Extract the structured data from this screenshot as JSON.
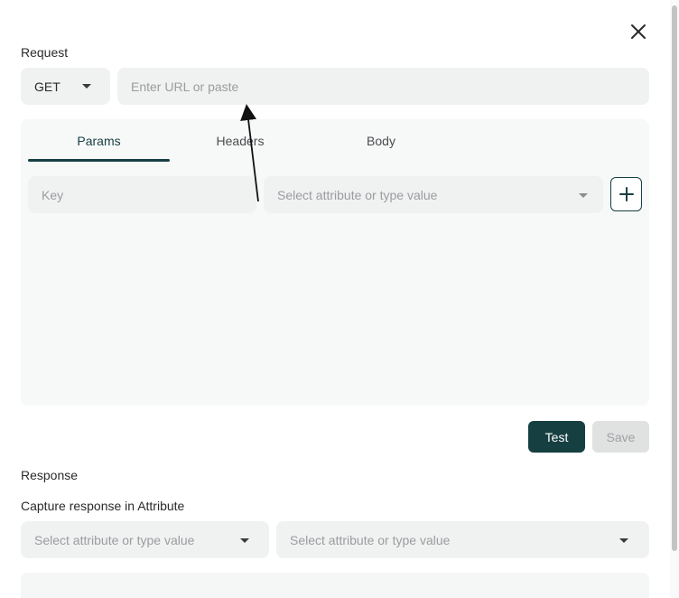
{
  "request": {
    "section_label": "Request",
    "method": {
      "value": "GET"
    },
    "url": {
      "placeholder": "Enter URL or paste"
    },
    "tabs": [
      {
        "label": "Params",
        "active": true
      },
      {
        "label": "Headers",
        "active": false
      },
      {
        "label": "Body",
        "active": false
      }
    ],
    "params": {
      "key_placeholder": "Key",
      "value_placeholder": "Select attribute or type value"
    },
    "test_label": "Test",
    "save_label": "Save"
  },
  "response": {
    "section_label": "Response",
    "capture_label": "Capture response in Attribute",
    "attribute_select_placeholder": "Select attribute or type value",
    "value_select_placeholder": "Select attribute or type value"
  },
  "colors": {
    "primary": "#163f42",
    "field_bg": "#f0f1f1",
    "panel_bg": "#f7f8f8",
    "disabled_bg": "#e0e1e1"
  },
  "icons": {
    "close": "close-icon",
    "add": "plus-icon",
    "dropdown": "caret-down-icon"
  }
}
